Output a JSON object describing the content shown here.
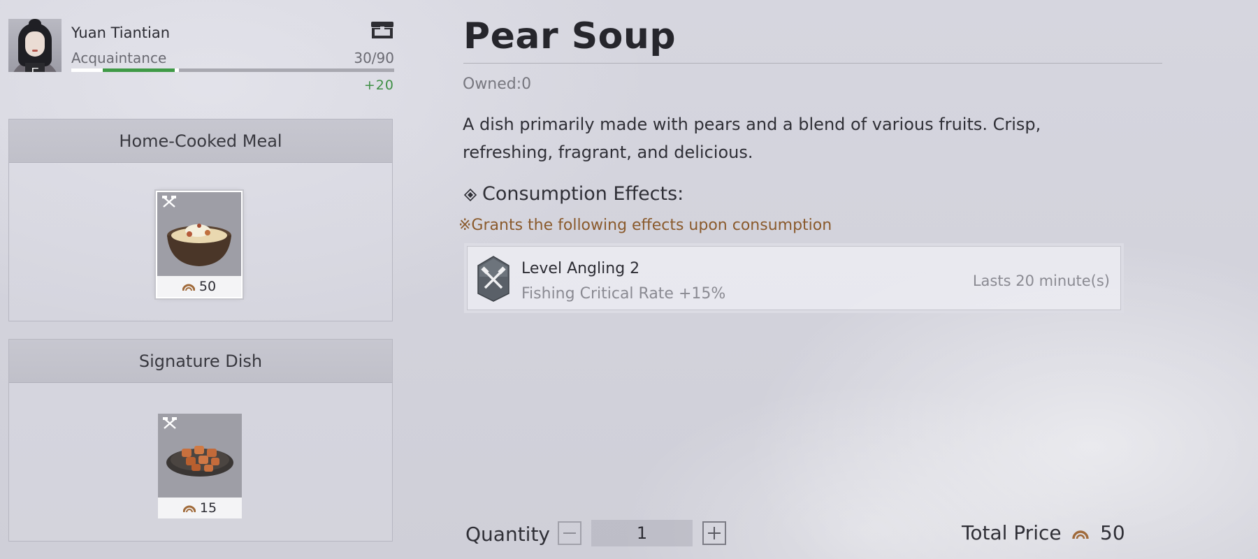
{
  "npc": {
    "name": "Yuan Tiantian",
    "gender_badge": "F",
    "relation": "Acquaintance",
    "progress_text": "30/90",
    "progress_fraction": 0.333,
    "gain_text": "+20",
    "gain_fraction": 0.222,
    "icons": {
      "portrait": "npc-portrait",
      "gift": "chest-icon"
    },
    "colors": {
      "progress": "#ffffff",
      "gain": "#3f9a46"
    }
  },
  "sections": [
    {
      "title": "Home-Cooked Meal",
      "items": [
        {
          "price": "50",
          "selected": true,
          "icon": "pear-soup-bowl"
        }
      ]
    },
    {
      "title": "Signature Dish",
      "items": [
        {
          "price": "15",
          "selected": false,
          "icon": "braised-pork-plate"
        }
      ]
    }
  ],
  "detail": {
    "title": "Pear Soup",
    "owned": "Owned:0",
    "description": "A dish primarily made with pears and a blend of various fruits. Crisp, refreshing, fragrant, and delicious.",
    "effects_heading": "Consumption Effects:",
    "effects_note": "※Grants the following effects upon consumption",
    "effects": [
      {
        "name": "Level Angling 2",
        "detail": "Fishing Critical Rate +15%",
        "duration": "Lasts 20 minute(s)",
        "icon": "angling-icon"
      }
    ]
  },
  "purchase": {
    "quantity_label": "Quantity",
    "quantity_value": "1",
    "total_label": "Total Price",
    "total_value": "50",
    "currency_icon": "coin-icon"
  }
}
